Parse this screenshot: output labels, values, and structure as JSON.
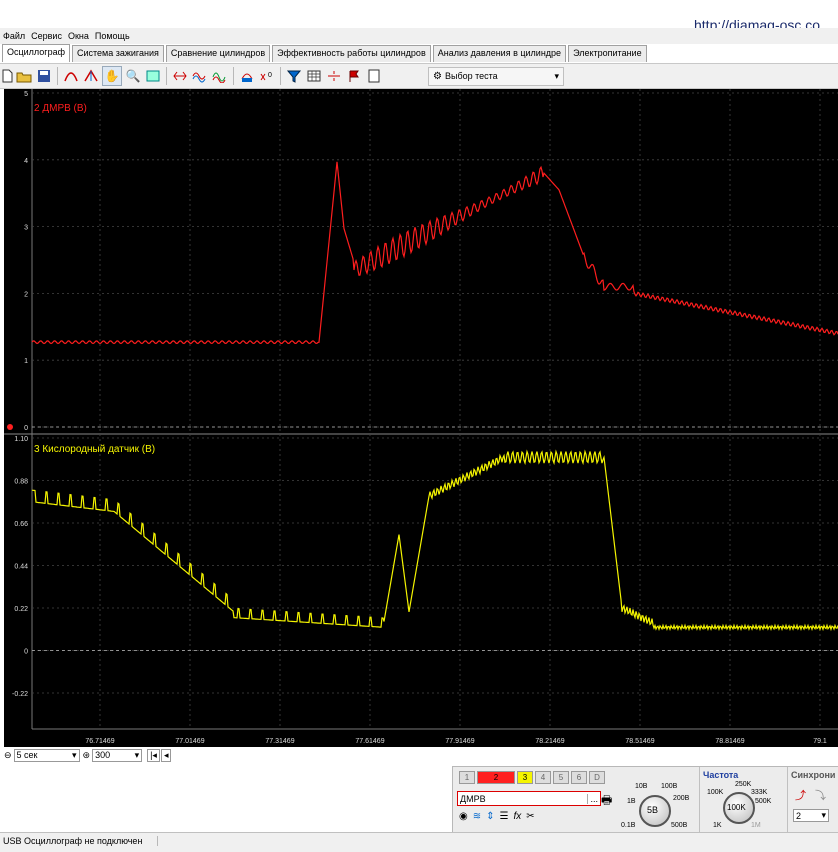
{
  "window": {
    "url": "http://diamag-osc.co"
  },
  "menu": [
    "Файл",
    "Сервис",
    "Окна",
    "Помощь"
  ],
  "tabs": [
    {
      "label": "Осциллограф",
      "active": true
    },
    {
      "label": "Система зажигания",
      "active": false
    },
    {
      "label": "Сравнение цилиндров",
      "active": false
    },
    {
      "label": "Эффективность работы цилиндров",
      "active": false
    },
    {
      "label": "Анализ давления в цилиндре",
      "active": false
    },
    {
      "label": "Электропитание",
      "active": false
    }
  ],
  "toolbar": {
    "test_select": "Выбор теста"
  },
  "icons": [
    "new-file-icon",
    "open-folder-icon",
    "save-icon",
    "cursor-icon",
    "peak-icon",
    "hand-icon",
    "zoom-icon",
    "grid-icon",
    "stretch-icon",
    "waveform-icon",
    "waveform2-icon",
    "auto-icon",
    "zero-icon",
    "filter-icon",
    "table-icon",
    "split-icon",
    "flag-icon",
    "document-icon",
    "test-icon"
  ],
  "scope": {
    "top_channel": {
      "label": "2 ДМРВ (В)",
      "color": "#ff1e1e",
      "y_ticks": [
        "5",
        "4",
        "3",
        "2",
        "1",
        "0"
      ]
    },
    "bottom_channel": {
      "label": "3 Кислородный датчик (В)",
      "color": "#f5f500",
      "y_ticks": [
        "1.10",
        "0.88",
        "0.66",
        "0.44",
        "0.22",
        "0",
        "-0.22"
      ]
    },
    "x_ticks": [
      "76.71469",
      "77.01469",
      "77.31469",
      "77.61469",
      "77.91469",
      "78.21469",
      "78.51469",
      "78.81469",
      "79.1"
    ]
  },
  "timebar": {
    "time_per_div": "5 сек",
    "points": "300"
  },
  "panel": {
    "channels": [
      "1",
      "2",
      "3",
      "4",
      "5",
      "6",
      "D"
    ],
    "active_channel": "2",
    "channel_name": "ДМРВ",
    "scale_knob": {
      "value": "5В",
      "labels": [
        "10В",
        "100В",
        "1В",
        "200В",
        "0.1В",
        "500В"
      ]
    },
    "frequency_title": "Частота",
    "freq_knob": {
      "value": "100K",
      "labels": [
        "250K",
        "100K",
        "333K",
        "500K",
        "1K",
        "1M"
      ]
    },
    "sync_title": "Синхрони",
    "sync_value": "2"
  },
  "status": {
    "text": "USB Осциллограф не подключен"
  },
  "colors": {
    "trace_red": "#ff1e1e",
    "trace_yellow": "#f5f500",
    "grid": "#444444"
  }
}
